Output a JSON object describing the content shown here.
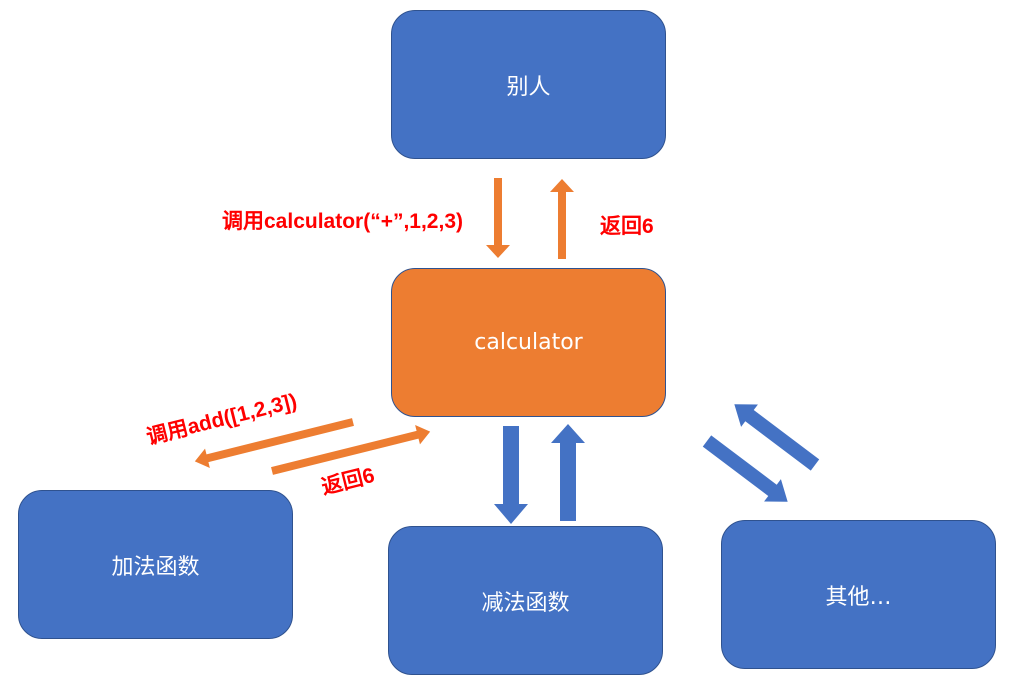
{
  "nodes": {
    "person": "别人",
    "calculator": "calculator",
    "add_function": "加法函数",
    "sub_function": "减法函数",
    "other": "其他…"
  },
  "labels": {
    "call_calculator": "调用calculator(“+”,1,2,3)",
    "return_top": "返回6",
    "call_add": "调用add([1,2,3])",
    "return_add": "返回6"
  },
  "colors": {
    "blue": "#4472c4",
    "orange": "#ed7d31",
    "label_red": "#ff0000"
  }
}
